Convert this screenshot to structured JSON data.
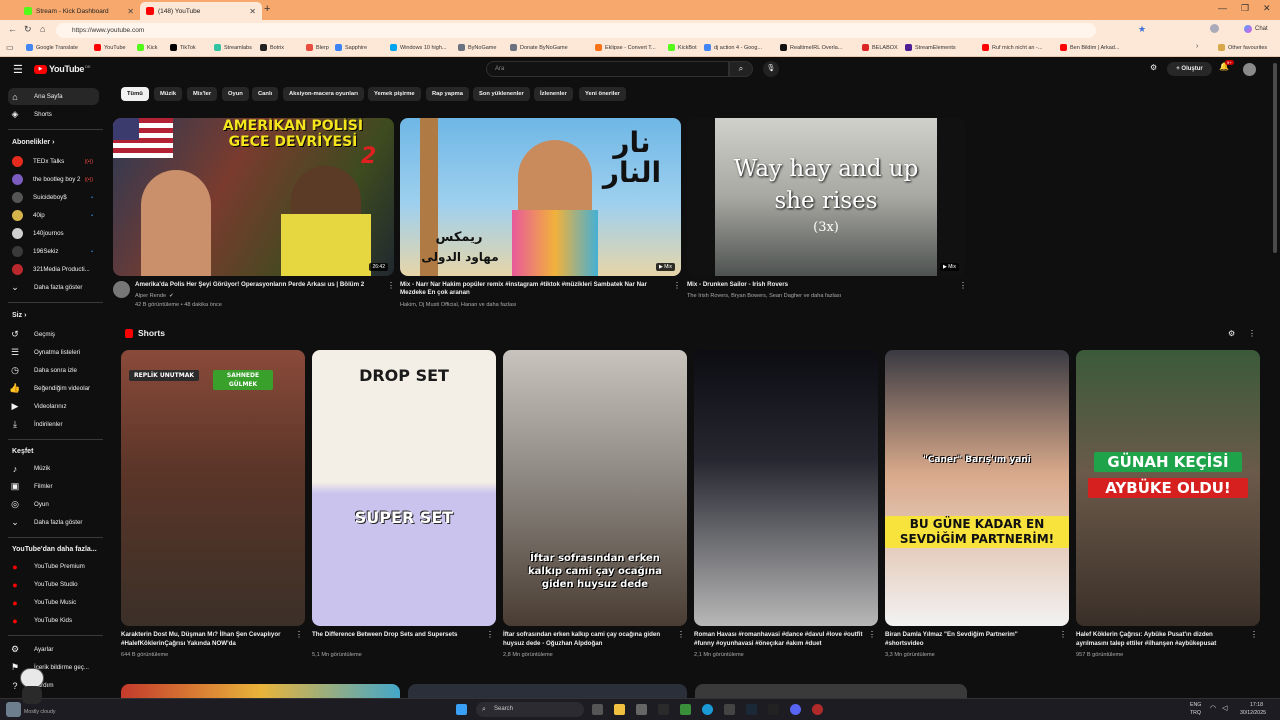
{
  "browser": {
    "tabs": [
      {
        "label": "Stream - Kick Dashboard",
        "color": "#53fc18"
      },
      {
        "label": "(148) YouTube",
        "color": "#ff0000"
      }
    ],
    "new_tab": "+",
    "url": "https://www.youtube.com",
    "bookmarks": [
      {
        "label": "Google Translate",
        "color": "#4285f4"
      },
      {
        "label": "YouTube",
        "color": "#ff0000"
      },
      {
        "label": "Kick",
        "color": "#53fc18"
      },
      {
        "label": "TikTok",
        "color": "#000000"
      },
      {
        "label": "Streamlabs",
        "color": "#31c3a2"
      },
      {
        "label": "Botrix",
        "color": "#222222"
      },
      {
        "label": "Blerp",
        "color": "#e84c3d"
      },
      {
        "label": "Sapphire",
        "color": "#3b82f6"
      },
      {
        "label": "Windows 10 high...",
        "color": "#00a4ef"
      },
      {
        "label": "ByNoGame",
        "color": "#6b7280"
      },
      {
        "label": "Donate ByNoGame",
        "color": "#6b7280"
      },
      {
        "label": "Eklipse - Convert T...",
        "color": "#f97316"
      },
      {
        "label": "KickBot",
        "color": "#53fc18"
      },
      {
        "label": "dj action 4 - Goog...",
        "color": "#4285f4"
      },
      {
        "label": "RealtimeIRL Overla...",
        "color": "#111111"
      },
      {
        "label": "BELABOX",
        "color": "#dc2626"
      },
      {
        "label": "StreamElements",
        "color": "#4c1d95"
      },
      {
        "label": "Ruf mich nicht an -...",
        "color": "#ff0000"
      },
      {
        "label": "Ben Bildim | Arkad...",
        "color": "#ff0000"
      }
    ],
    "other_favourites": "Other favourites",
    "chat": "Chat"
  },
  "header": {
    "logo": "YouTube",
    "logo_region": "DE",
    "search_placeholder": "Ara",
    "create_label": "Oluştur",
    "notif_count": "9+"
  },
  "sidebar": {
    "main": [
      {
        "label": "Ana Sayfa",
        "icon": "home-icon"
      },
      {
        "label": "Shorts",
        "icon": "shorts-icon"
      }
    ],
    "subs_title": "Abonelikler",
    "subs": [
      {
        "label": "TEDx Talks",
        "color": "#e62b1e",
        "live": true
      },
      {
        "label": "the bootleg boy 2",
        "color": "#7c5cbf",
        "live": true
      },
      {
        "label": "Suicideboy$",
        "color": "#555555",
        "live": false
      },
      {
        "label": "40ip",
        "color": "#d4b44a",
        "live": false
      },
      {
        "label": "140journos",
        "color": "#cfcfcf",
        "live": false
      },
      {
        "label": "196Sekiz",
        "color": "#3a3a3a",
        "live": false
      },
      {
        "label": "321Media Producti...",
        "color": "#b8282c",
        "live": false
      }
    ],
    "subs_more": "Daha fazla göster",
    "you_title": "Siz",
    "you": [
      {
        "label": "Geçmiş"
      },
      {
        "label": "Oynatma listeleri"
      },
      {
        "label": "Daha sonra izle"
      },
      {
        "label": "Beğendiğim videolar"
      },
      {
        "label": "Videolarınız"
      },
      {
        "label": "İndirilenler"
      }
    ],
    "explore_title": "Keşfet",
    "explore": [
      {
        "label": "Müzik"
      },
      {
        "label": "Filmler"
      },
      {
        "label": "Oyun"
      },
      {
        "label": "Daha fazla göster"
      }
    ],
    "more_title": "YouTube'dan daha fazla...",
    "more": [
      {
        "label": "YouTube Premium"
      },
      {
        "label": "YouTube Studio"
      },
      {
        "label": "YouTube Music"
      },
      {
        "label": "YouTube Kids"
      }
    ],
    "settings": "Ayarlar",
    "report": "İçerik bildirme geç...",
    "help": "Yardım"
  },
  "chips": [
    "Tümü",
    "Müzik",
    "Mix'ler",
    "Oyun",
    "Canlı",
    "Aksiyon-macera oyunları",
    "Yemek pişirme",
    "Rap yapma",
    "Son yüklenenler",
    "İzlenenler",
    "Yeni öneriler"
  ],
  "videos": [
    {
      "title": "Amerika'da Polis Her Şeyi Görüyor! Operasyonların Perde Arkası us | Bölüm 2",
      "channel": "Alper Rende",
      "meta": "42 B görüntüleme • 48 dakika önce",
      "duration": "26:42",
      "overlay1": "AMERİKAN POLİSİ",
      "overlay2": "GECE DEVRİYESİ",
      "overlay_num": "2"
    },
    {
      "title": "Mix - Narr Nar Hakim popüler remix #instagram #tiktok #müzikleri Sambatek Nar Nar Mezdeke En çok aranan",
      "channel": "",
      "meta": "Hakim, Dj Musti Official, Hanan ve daha fazlası",
      "duration": "Mix",
      "overlay1": "نار النار",
      "overlay2": "ريمكس",
      "overlay_num": "مهاود الدولى"
    },
    {
      "title": "Mix - Drunken Sailor - Irish Rovers",
      "channel": "",
      "meta": "The Irish Rovers, Bryan Bowers, Sean Dagher ve daha fazlası",
      "duration": "Mix",
      "overlay1": "Way hay and up",
      "overlay2": "she rises",
      "overlay_num": "(3x)"
    }
  ],
  "shorts_title": "Shorts",
  "shorts": [
    {
      "title": "Karakterin Dost Mu, Düşman Mı? İlhan Şen Cevaplıyor #HalefKöklerinÇağrısı Yakında NOW'da",
      "views": "644 B görüntüleme",
      "tag1": "REPLİK UNUTMAK",
      "tag2": "SAHNEDE GÜLMEK"
    },
    {
      "title": "The Difference Between Drop Sets and Supersets",
      "views": "5,1 Mn görüntüleme",
      "tag1": "DROP SET",
      "tag2": "SUPER SET"
    },
    {
      "title": "İftar sofrasından erken kalkıp cami çay ocağına giden huysuz dede - Oğuzhan Alpdoğan",
      "views": "2,8 Mn görüntüleme",
      "tag1": "İftar sofrasından erken kalkıp cami çay ocağına giden huysuz dede",
      "tag2": ""
    },
    {
      "title": "Roman Havası #romanhavasi #dance #davul #love #outfit #funny #oyunhavasi #öneçıkar #akım #duet",
      "views": "2,1 Mn görüntüleme",
      "tag1": "",
      "tag2": ""
    },
    {
      "title": "Biran Damla Yılmaz \"En Sevdiğim Partnerim\" #shortsvideo",
      "views": "3,3 Mn görüntüleme",
      "tag1": "\"Caner\" Barış'ım yani",
      "tag2": "BU GÜNE KADAR EN SEVDİĞİM PARTNERİM!"
    },
    {
      "title": "Halef Köklerin Çağrısı: Aybüke Pusat'ın dizden ayrılmasını talep ettiler #ilhanşen #aybükepusat",
      "views": "957 B görüntüleme",
      "tag1": "GÜNAH KEÇİSİ",
      "tag2": "AYBÜKE OLDU!"
    }
  ],
  "taskbar": {
    "search": "Search",
    "lang1": "ENG",
    "lang2": "TRQ",
    "time": "17:18",
    "date": "30/12/2025",
    "weather": "Mostly cloudy"
  }
}
